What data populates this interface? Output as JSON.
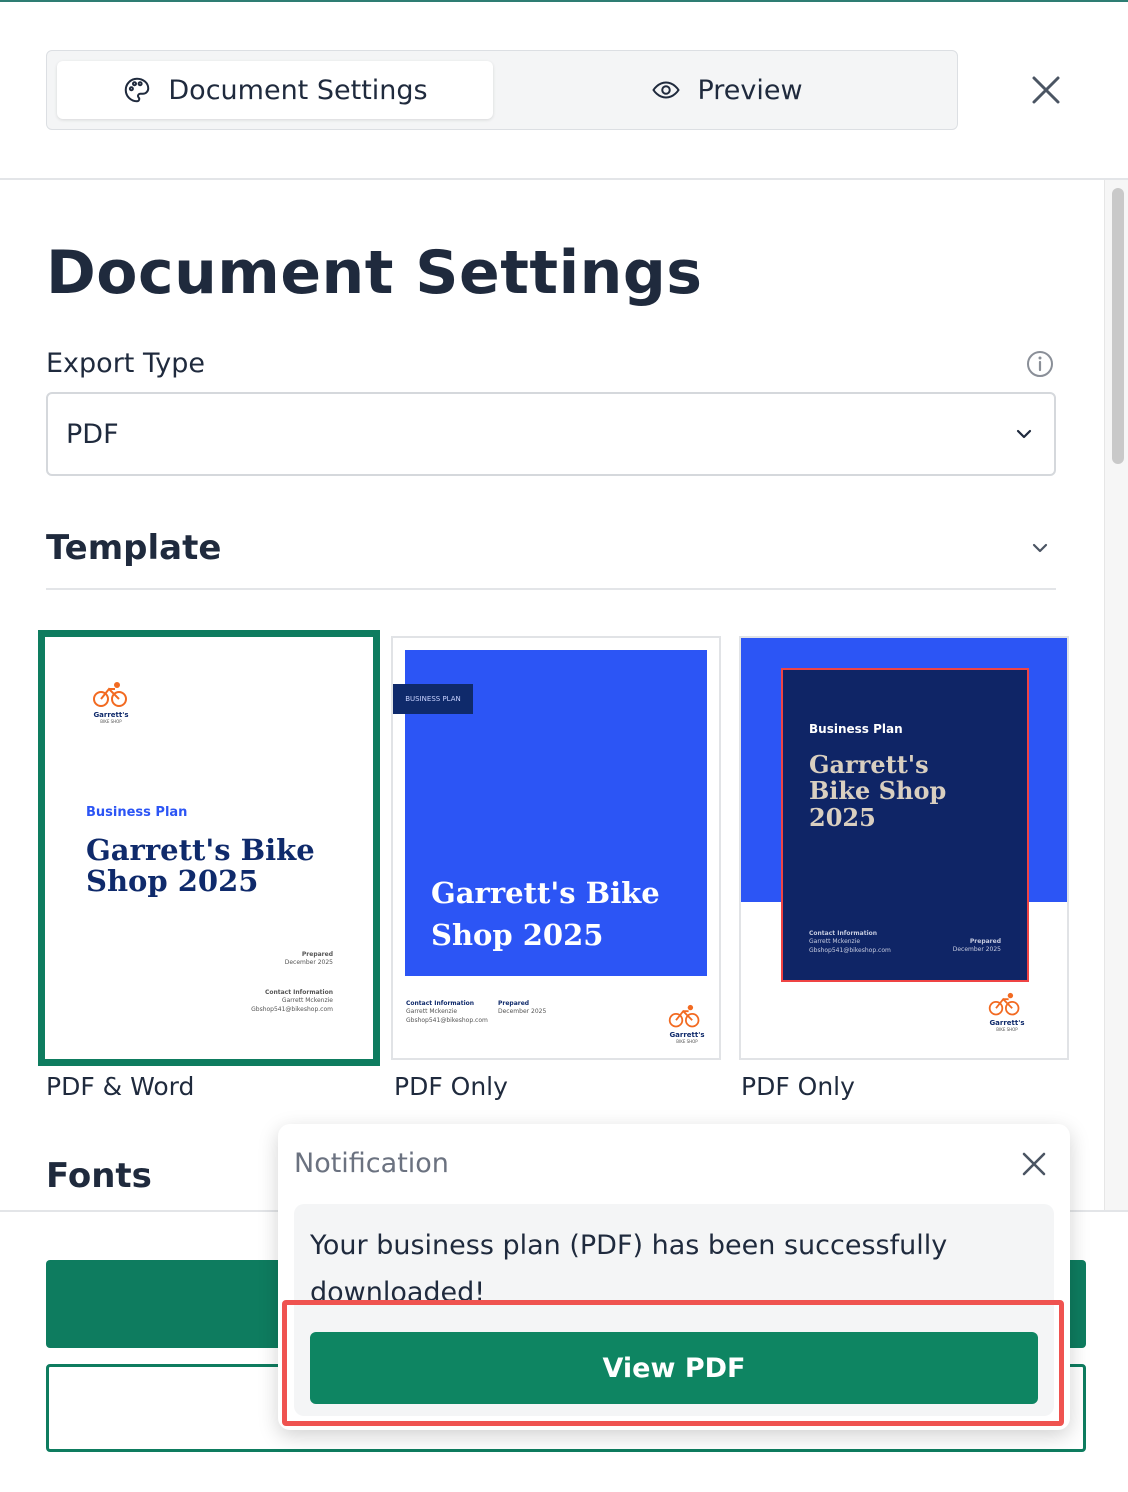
{
  "tabs": [
    {
      "label": "Document Settings",
      "icon": "palette-icon",
      "active": true
    },
    {
      "label": "Preview",
      "icon": "eye-icon",
      "active": false
    }
  ],
  "page": {
    "title": "Document Settings"
  },
  "export": {
    "label": "Export Type",
    "selected": "PDF"
  },
  "template": {
    "heading": "Template",
    "cards": [
      {
        "label": "PDF & Word",
        "subtitle": "Business Plan",
        "title": "Garrett's Bike Shop 2025",
        "logo_name": "Garrett's",
        "logo_sub": "BIKE SHOP",
        "prepared_label": "Prepared",
        "prepared_date": "December 2025",
        "contact_label": "Contact Information",
        "contact_name": "Garrett Mckenzie",
        "contact_email": "Gbshop541@bikeshop.com"
      },
      {
        "label": "PDF Only",
        "tag": "BUSINESS PLAN",
        "title": "Garrett's Bike Shop 2025",
        "logo_name": "Garrett's",
        "logo_sub": "BIKE SHOP",
        "prepared_label": "Prepared",
        "prepared_date": "December 2025",
        "contact_label": "Contact Information",
        "contact_name": "Garrett Mckenzie",
        "contact_email": "Gbshop541@bikeshop.com"
      },
      {
        "label": "PDF Only",
        "subtitle": "Business Plan",
        "title": "Garrett's Bike Shop 2025",
        "logo_name": "Garrett's",
        "logo_sub": "BIKE SHOP",
        "prepared_label": "Prepared",
        "prepared_date": "December 2025",
        "contact_label": "Contact Information",
        "contact_name": "Garrett Mckenzie",
        "contact_email": "Gbshop541@bikeshop.com"
      }
    ]
  },
  "fonts": {
    "heading": "Fonts"
  },
  "notification": {
    "title": "Notification",
    "message": "Your business plan (PDF) has been successfully downloaded!",
    "button": "View PDF"
  },
  "colors": {
    "accent": "#0e7c5f",
    "navy": "#0f2a6b",
    "blue": "#2c55f5",
    "highlight": "#ef5350"
  }
}
